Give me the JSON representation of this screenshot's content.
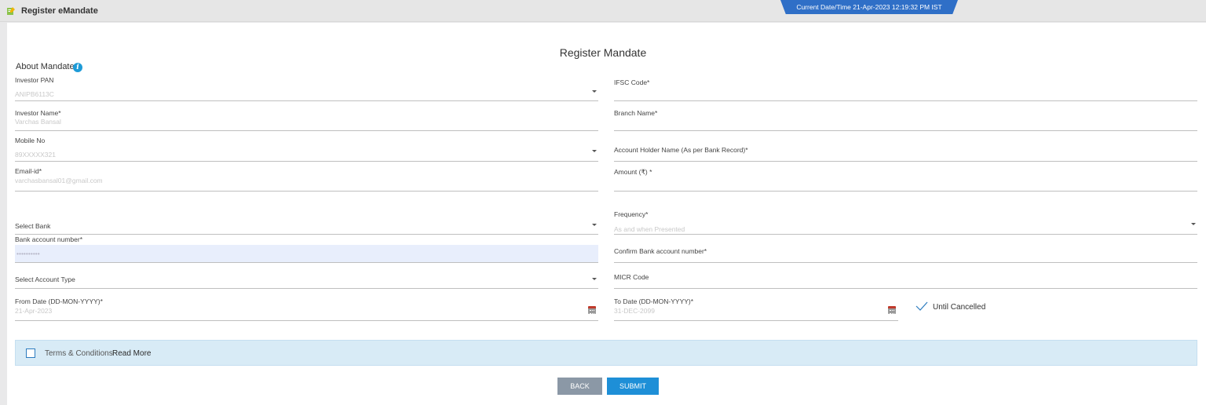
{
  "header": {
    "title": "Register eMandate",
    "datetime": "Current Date/Time 21-Apr-2023 12:19:32 PM IST"
  },
  "form": {
    "title": "Register Mandate",
    "section": "About Mandate",
    "left": {
      "investor_pan": {
        "label": "Investor PAN",
        "value": "ANIPB6113C"
      },
      "investor_name": {
        "label": "Investor Name*",
        "value": "Varchas Bansal"
      },
      "mobile": {
        "label": "Mobile No",
        "value": "89XXXXX321"
      },
      "email": {
        "label": "Email-id*",
        "value": "varchasbansal01@gmail.com"
      },
      "bank": {
        "label": "Select Bank"
      },
      "account_number": {
        "label": "Bank account number*",
        "value": "••••••••••"
      },
      "account_type": {
        "label": "Select Account Type"
      },
      "from_date": {
        "label": "From Date (DD-MON-YYYY)*",
        "value": "21-Apr-2023"
      }
    },
    "right": {
      "ifsc": {
        "label": "IFSC Code*"
      },
      "branch": {
        "label": "Branch Name*"
      },
      "holder": {
        "label": "Account Holder Name (As per Bank Record)*"
      },
      "amount": {
        "label": "Amount (₹) *"
      },
      "frequency": {
        "label": "Frequency*",
        "value": "As and when Presented"
      },
      "confirm_account": {
        "label": "Confirm Bank account number*"
      },
      "micr": {
        "label": "MICR Code"
      },
      "to_date": {
        "label": "To Date (DD-MON-YYYY)*",
        "value": "31-DEC-2099"
      },
      "until_cancelled": "Until Cancelled"
    },
    "terms": {
      "text": "Terms & Conditions",
      "read_more": "Read More"
    },
    "buttons": {
      "back": "BACK",
      "submit": "SUBMIT"
    }
  },
  "colors": {
    "accent": "#1e8fd7",
    "banner": "#2f6fc7",
    "terms_bg": "#d8ebf6"
  }
}
